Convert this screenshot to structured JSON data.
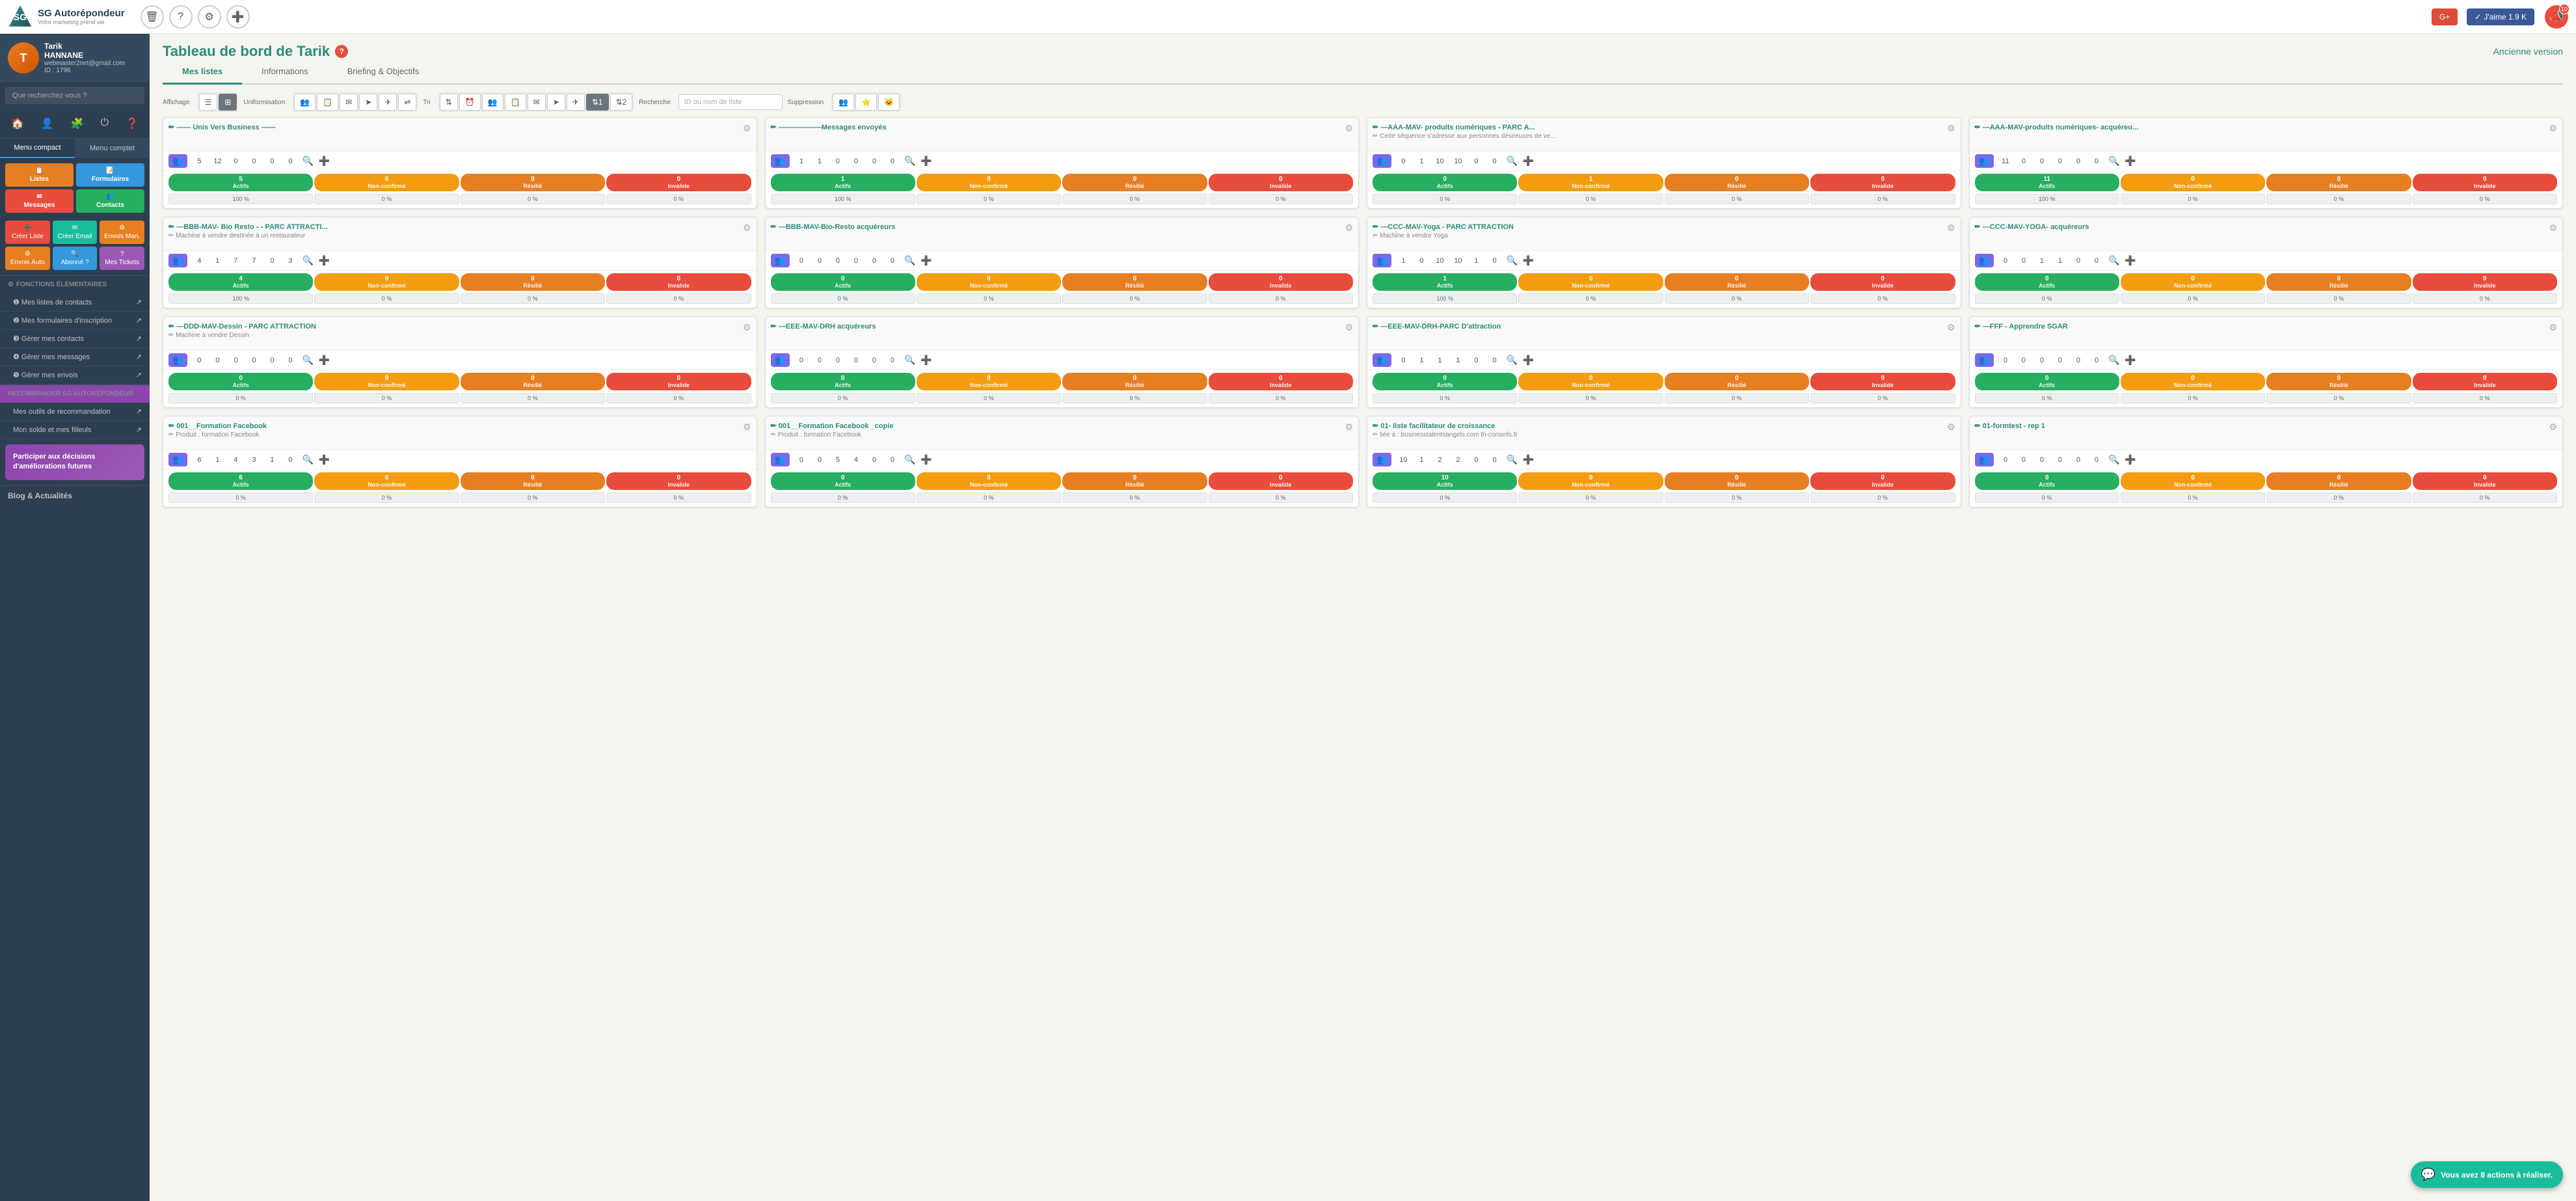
{
  "app": {
    "title": "SG Autorépondeur",
    "subtitle": "Votre marketing prend vie"
  },
  "topbar": {
    "delete_label": "🗑",
    "help_label": "?",
    "settings_label": "⚙",
    "add_user_label": "➕",
    "gplus_label": "G+",
    "like_label": "✓ J'aime 1.9 K",
    "notif_count": "10"
  },
  "user": {
    "first_name": "Tarik",
    "last_name": "HANNANE",
    "email": "webmaster2net@gmail.com",
    "id": "ID : 1796",
    "initials": "T"
  },
  "sidebar": {
    "search_placeholder": "Que recherchez-vous ?",
    "menu_compact": "Menu compact",
    "menu_complet": "Menu complet",
    "quick_btns": [
      {
        "label": "Listes",
        "color": "qbtn-orange"
      },
      {
        "label": "Formulaires",
        "color": "qbtn-blue"
      },
      {
        "label": "Messages",
        "color": "qbtn-red"
      },
      {
        "label": "Contacts",
        "color": "qbtn-green"
      }
    ],
    "action_btns": [
      {
        "label": "Créer Liste",
        "color": "qbtn-red",
        "icon": "➕"
      },
      {
        "label": "Créer Email",
        "color": "qbtn-teal",
        "icon": "✉"
      },
      {
        "label": "Envois Man.",
        "color": "qbtn-orange",
        "icon": "⚙"
      },
      {
        "label": "Envois Auto",
        "color": "qbtn-orange",
        "icon": "⚙"
      },
      {
        "label": "Abonné ?",
        "color": "qbtn-blue",
        "icon": "🔍"
      },
      {
        "label": "Mes Tickets",
        "color": "qbtn-purple",
        "icon": "?"
      }
    ],
    "sections": [
      {
        "title": "FONCTIONS ÉLÉMENTAIRES",
        "links": [
          "Mes listes de contacts",
          "Mes formulaires d'inscription",
          "Gérer mes contacts",
          "Gérer mes messages",
          "Gérer mes envois"
        ]
      }
    ],
    "recommend_title": "RECOMMANDER SG AUTORÉPONDEUR",
    "recommend_links": [
      "Mes outils de recommandation",
      "Mon solde et mes filleuls"
    ],
    "participer_text": "Participer aux décisions d'améliorations futures",
    "blog_title": "Blog & Actualités"
  },
  "dashboard": {
    "title": "Tableau de bord de Tarik",
    "old_version": "Ancienne version",
    "tabs": [
      "Mes listes",
      "Informations",
      "Briefing & Objectifs"
    ],
    "active_tab": 0
  },
  "toolbar": {
    "affichage_label": "Affichage",
    "uniformisation_label": "Uniformisation",
    "tri_label": "Tri",
    "recherche_label": "Recherche",
    "suppression_label": "Suppression",
    "search_placeholder": "ID ou nom de liste"
  },
  "cards": [
    {
      "title": "—— Unis Vers Business ——",
      "subtitle": "",
      "stats": [
        5,
        12,
        0,
        0,
        0,
        0
      ],
      "actifs": 5,
      "non_confirme": 0,
      "resilie": 0,
      "invalide": 0,
      "actifs_pct": "100 %",
      "nc_pct": "0 %",
      "res_pct": "0 %",
      "inv_pct": "0 %"
    },
    {
      "title": "——————Messages envoyés",
      "subtitle": "",
      "stats": [
        1,
        1,
        0,
        0,
        0,
        0
      ],
      "actifs": 1,
      "non_confirme": 0,
      "resilie": 0,
      "invalide": 0,
      "actifs_pct": "100 %",
      "nc_pct": "0 %",
      "res_pct": "0 %",
      "inv_pct": "0 %"
    },
    {
      "title": "—AAA-MAV- produits numériques - PARC A...",
      "subtitle": "Cette séquence s'adresse aux personnes désireuses de ve...",
      "stats": [
        0,
        1,
        10,
        10,
        0,
        0
      ],
      "actifs": 0,
      "non_confirme": 1,
      "resilie": 0,
      "invalide": 0,
      "actifs_pct": "0 %",
      "nc_pct": "0 %",
      "res_pct": "0 %",
      "inv_pct": "0 %"
    },
    {
      "title": "—AAA-MAV-produits numériques- acquéreu...",
      "subtitle": "",
      "stats": [
        11,
        0,
        0,
        0,
        0,
        0
      ],
      "actifs": 11,
      "non_confirme": 0,
      "resilie": 0,
      "invalide": 0,
      "actifs_pct": "100 %",
      "nc_pct": "0 %",
      "res_pct": "0 %",
      "inv_pct": "0 %"
    },
    {
      "title": "—BBB-MAV- Bio Resto - - PARC ATTRACTI...",
      "subtitle": "Machine à vendre destinée à un restaurateur",
      "stats": [
        4,
        1,
        7,
        7,
        0,
        3
      ],
      "actifs": 4,
      "non_confirme": 0,
      "resilie": 0,
      "invalide": 0,
      "actifs_pct": "100 %",
      "nc_pct": "0 %",
      "res_pct": "0 %",
      "inv_pct": "0 %"
    },
    {
      "title": "—BBB-MAV-Bio-Resto acquéreurs",
      "subtitle": "",
      "stats": [
        0,
        0,
        0,
        0,
        0,
        0
      ],
      "actifs": 0,
      "non_confirme": 0,
      "resilie": 0,
      "invalide": 0,
      "actifs_pct": "0 %",
      "nc_pct": "0 %",
      "res_pct": "0 %",
      "inv_pct": "0 %"
    },
    {
      "title": "—CCC-MAV-Yoga - PARC ATTRACTION",
      "subtitle": "Machine à vendre Yoga",
      "stats": [
        1,
        0,
        10,
        10,
        1,
        0
      ],
      "actifs": 1,
      "non_confirme": 0,
      "resilie": 0,
      "invalide": 0,
      "actifs_pct": "100 %",
      "nc_pct": "0 %",
      "res_pct": "0 %",
      "inv_pct": "0 %"
    },
    {
      "title": "—CCC-MAV-YOGA- acquéreurs",
      "subtitle": "",
      "stats": [
        0,
        0,
        1,
        1,
        0,
        0
      ],
      "actifs": 0,
      "non_confirme": 0,
      "resilie": 0,
      "invalide": 0,
      "actifs_pct": "0 %",
      "nc_pct": "0 %",
      "res_pct": "0 %",
      "inv_pct": "0 %"
    },
    {
      "title": "—DDD-MAV-Dessin - PARC ATTRACTION",
      "subtitle": "Machine à vendre Dessin",
      "stats": [
        0,
        0,
        0,
        0,
        0,
        0
      ],
      "actifs": 0,
      "non_confirme": 0,
      "resilie": 0,
      "invalide": 0,
      "actifs_pct": "0 %",
      "nc_pct": "0 %",
      "res_pct": "0 %",
      "inv_pct": "0 %"
    },
    {
      "title": "—EEE-MAV-DRH acquéreurs",
      "subtitle": "",
      "stats": [
        0,
        0,
        0,
        0,
        0,
        0
      ],
      "actifs": 0,
      "non_confirme": 0,
      "resilie": 0,
      "invalide": 0,
      "actifs_pct": "0 %",
      "nc_pct": "0 %",
      "res_pct": "0 %",
      "inv_pct": "0 %"
    },
    {
      "title": "—EEE-MAV-DRH-PARC D'attraction",
      "subtitle": "",
      "stats": [
        0,
        1,
        1,
        1,
        0,
        0
      ],
      "actifs": 0,
      "non_confirme": 0,
      "resilie": 0,
      "invalide": 0,
      "actifs_pct": "0 %",
      "nc_pct": "0 %",
      "res_pct": "0 %",
      "inv_pct": "0 %"
    },
    {
      "title": "—FFF - Apprendre SGAR",
      "subtitle": "",
      "stats": [
        0,
        0,
        0,
        0,
        0,
        0
      ],
      "actifs": 0,
      "non_confirme": 0,
      "resilie": 0,
      "invalide": 0,
      "actifs_pct": "0 %",
      "nc_pct": "0 %",
      "res_pct": "0 %",
      "inv_pct": "0 %"
    },
    {
      "title": "001__Formation Facebook",
      "subtitle": "Produit : formation Facebook",
      "stats": [
        6,
        1,
        4,
        3,
        1,
        0
      ],
      "actifs": 6,
      "non_confirme": 0,
      "resilie": 0,
      "invalide": 0,
      "actifs_pct": "0 %",
      "nc_pct": "0 %",
      "res_pct": "0 %",
      "inv_pct": "0 %"
    },
    {
      "title": "001__Formation Facebook _copie",
      "subtitle": "Produit : formation Facebook",
      "stats": [
        0,
        0,
        5,
        4,
        0,
        0
      ],
      "actifs": 0,
      "non_confirme": 0,
      "resilie": 0,
      "invalide": 0,
      "actifs_pct": "0 %",
      "nc_pct": "0 %",
      "res_pct": "0 %",
      "inv_pct": "0 %"
    },
    {
      "title": "01- liste facilitateur de croissance",
      "subtitle": "liée à : businesstalentsangels.com th-conseils.fr",
      "stats": [
        10,
        1,
        2,
        2,
        0,
        0
      ],
      "actifs": 10,
      "non_confirme": 0,
      "resilie": 0,
      "invalide": 0,
      "actifs_pct": "0 %",
      "nc_pct": "0 %",
      "res_pct": "0 %",
      "inv_pct": "0 %"
    },
    {
      "title": "01-formtest - rep 1",
      "subtitle": "",
      "stats": [
        0,
        0,
        0,
        0,
        0,
        0
      ],
      "actifs": 0,
      "non_confirme": 0,
      "resilie": 0,
      "invalide": 0,
      "actifs_pct": "0 %",
      "nc_pct": "0 %",
      "res_pct": "0 %",
      "inv_pct": "0 %"
    }
  ],
  "notifications": {
    "bubble_text": "Vous avez 8 actions à réaliser."
  }
}
